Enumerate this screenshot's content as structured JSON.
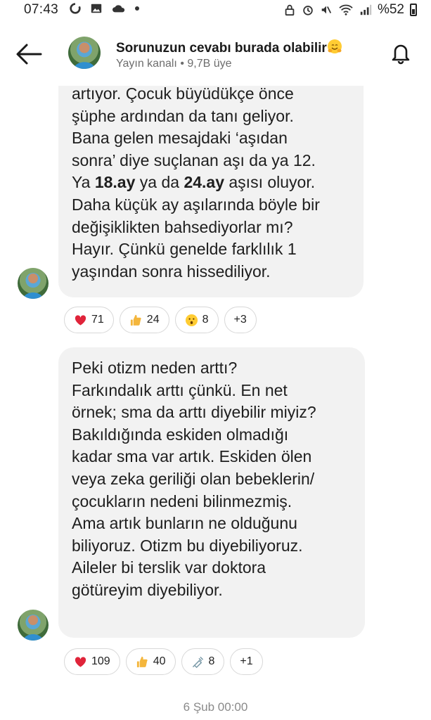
{
  "status_bar": {
    "time": "07:43",
    "battery": "%52",
    "icons": [
      "sync-icon",
      "image-icon",
      "cloud-icon",
      "dot-icon",
      "lock-icon",
      "alarm-icon",
      "mute-icon",
      "wifi-icon",
      "signal-icon",
      "battery-icon"
    ]
  },
  "header": {
    "title": "Sorunuzun cevabı burada olabilir",
    "subtitle": "Yayın kanalı • 9,7B üye",
    "title_emoji": "hugging-face-emoji"
  },
  "messages": [
    {
      "lines": [
        {
          "parts": [
            {
              "text": "artıyor. Çocuk büyüdükçe önce"
            }
          ]
        },
        {
          "parts": [
            {
              "text": "şüphe ardından da tanı geliyor."
            }
          ]
        },
        {
          "parts": [
            {
              "text": "Bana gelen mesajdaki ‘aşıdan"
            }
          ]
        },
        {
          "parts": [
            {
              "text": "sonra’ diye suçlanan aşı da ya 12."
            }
          ]
        },
        {
          "parts": [
            {
              "text": "Ya "
            },
            {
              "text": "18.ay",
              "bold": true
            },
            {
              "text": " ya da "
            },
            {
              "text": "24.ay",
              "bold": true
            },
            {
              "text": " aşısı oluyor."
            }
          ]
        },
        {
          "parts": [
            {
              "text": "Daha küçük ay aşılarında böyle bir"
            }
          ]
        },
        {
          "parts": [
            {
              "text": "değişiklikten bahsediyorlar mı?"
            }
          ]
        },
        {
          "parts": [
            {
              "text": "Hayır. Çünkü genelde farklılık 1"
            }
          ]
        },
        {
          "parts": [
            {
              "text": "yaşından sonra hissediliyor."
            }
          ]
        }
      ],
      "reactions": [
        {
          "icon": "heart-icon",
          "count": "71"
        },
        {
          "icon": "thumbs-up-icon",
          "count": "24"
        },
        {
          "icon": "hushed-face-icon",
          "count": "8"
        },
        {
          "icon": "",
          "count": "+3"
        }
      ]
    },
    {
      "lines": [
        {
          "parts": [
            {
              "text": "Peki otizm neden arttı?"
            }
          ]
        },
        {
          "parts": [
            {
              "text": " "
            }
          ]
        },
        {
          "parts": [
            {
              "text": "Farkındalık arttı çünkü. En net"
            }
          ]
        },
        {
          "parts": [
            {
              "text": "örnek; sma da arttı diyebilir miyiz?"
            }
          ]
        },
        {
          "parts": [
            {
              "text": "Bakıldığında eskiden olmadığı"
            }
          ]
        },
        {
          "parts": [
            {
              "text": "kadar sma var artık. Eskiden ölen"
            }
          ]
        },
        {
          "parts": [
            {
              "text": "veya zeka geriliği olan bebeklerin/"
            }
          ]
        },
        {
          "parts": [
            {
              "text": "çocukların nedeni bilinmezmiş."
            }
          ]
        },
        {
          "parts": [
            {
              "text": "Ama artık bunların ne olduğunu"
            }
          ]
        },
        {
          "parts": [
            {
              "text": "biliyoruz. Otizm bu diyebiliyoruz."
            }
          ]
        },
        {
          "parts": [
            {
              "text": "Aileler bi terslik var doktora"
            }
          ]
        },
        {
          "parts": [
            {
              "text": "götüreyim diyebiliyor."
            }
          ]
        }
      ],
      "reactions": [
        {
          "icon": "heart-icon",
          "count": "109"
        },
        {
          "icon": "thumbs-up-icon",
          "count": "40"
        },
        {
          "icon": "syringe-icon",
          "count": "8"
        },
        {
          "icon": "",
          "count": "+1"
        }
      ]
    }
  ],
  "date_stamp": "6 Şub 00:00",
  "colors": {
    "bubble": "#f2f2f2",
    "heart": "#e0243a",
    "thumb": "#f4b63c",
    "subtle_text": "#6d6d6d"
  }
}
